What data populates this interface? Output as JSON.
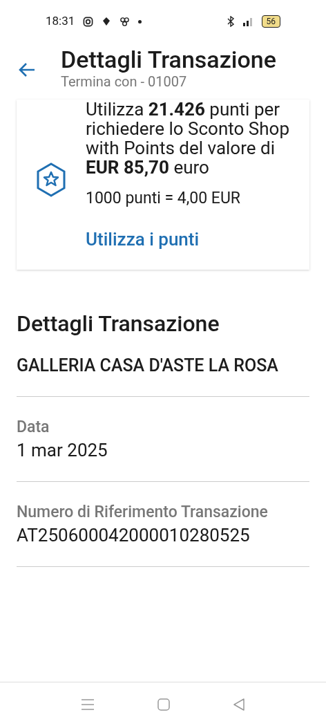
{
  "status_bar": {
    "time": "18:31",
    "battery": "56"
  },
  "header": {
    "title": "Dettagli Transazione",
    "subtitle": "Termina con - 01007"
  },
  "points_card": {
    "message": "Utilizza **21.426** punti per richiedere lo Sconto Shop with Points del valore di **EUR 85,70** euro",
    "rate": "1000 punti = 4,00 EUR",
    "action": "Utilizza i punti"
  },
  "details": {
    "title": "Dettagli Transazione",
    "merchant": "GALLERIA CASA D'ASTE LA ROSA",
    "fields": [
      {
        "label": "Data",
        "value": "1 mar 2025"
      },
      {
        "label": "Numero di Riferimento Transazione",
        "value": "AT250600042000010280525"
      }
    ]
  }
}
